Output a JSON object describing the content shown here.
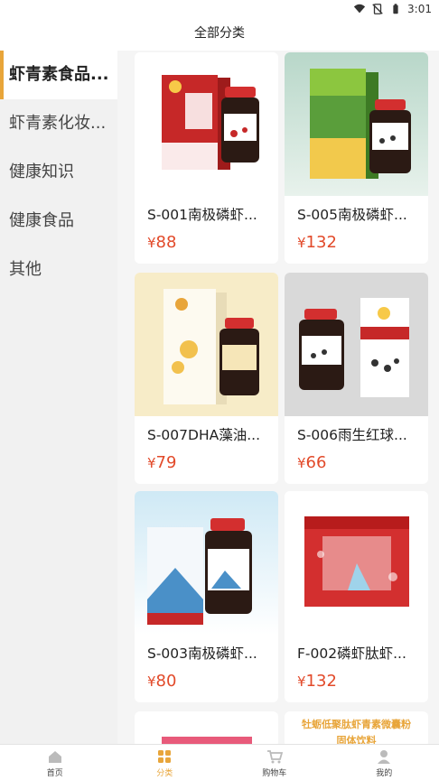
{
  "status": {
    "time": "3:01"
  },
  "header": {
    "title": "全部分类"
  },
  "sidebar": {
    "items": [
      {
        "label": "虾青素食品..."
      },
      {
        "label": "虾青素化妆..."
      },
      {
        "label": "健康知识"
      },
      {
        "label": "健康食品"
      },
      {
        "label": "其他"
      }
    ]
  },
  "products": [
    {
      "name": "S-001南极磷虾...",
      "price": "88",
      "currency": "¥"
    },
    {
      "name": "S-005南极磷虾...",
      "price": "132",
      "currency": "¥"
    },
    {
      "name": "S-007DHA藻油...",
      "price": "79",
      "currency": "¥"
    },
    {
      "name": "S-006雨生红球...",
      "price": "66",
      "currency": "¥"
    },
    {
      "name": "S-003南极磷虾...",
      "price": "80",
      "currency": "¥"
    },
    {
      "name": "F-002磷虾肽虾...",
      "price": "132",
      "currency": "¥"
    }
  ],
  "partial_banner": {
    "line1": "牡蛎低聚肽虾青素微囊粉",
    "line2": "固体饮料"
  },
  "bottom_nav": {
    "items": [
      {
        "label": "首页"
      },
      {
        "label": "分类"
      },
      {
        "label": "购物车"
      },
      {
        "label": "我的"
      }
    ]
  },
  "colors": {
    "accent": "#e8a53a",
    "price": "#e24a2a"
  }
}
